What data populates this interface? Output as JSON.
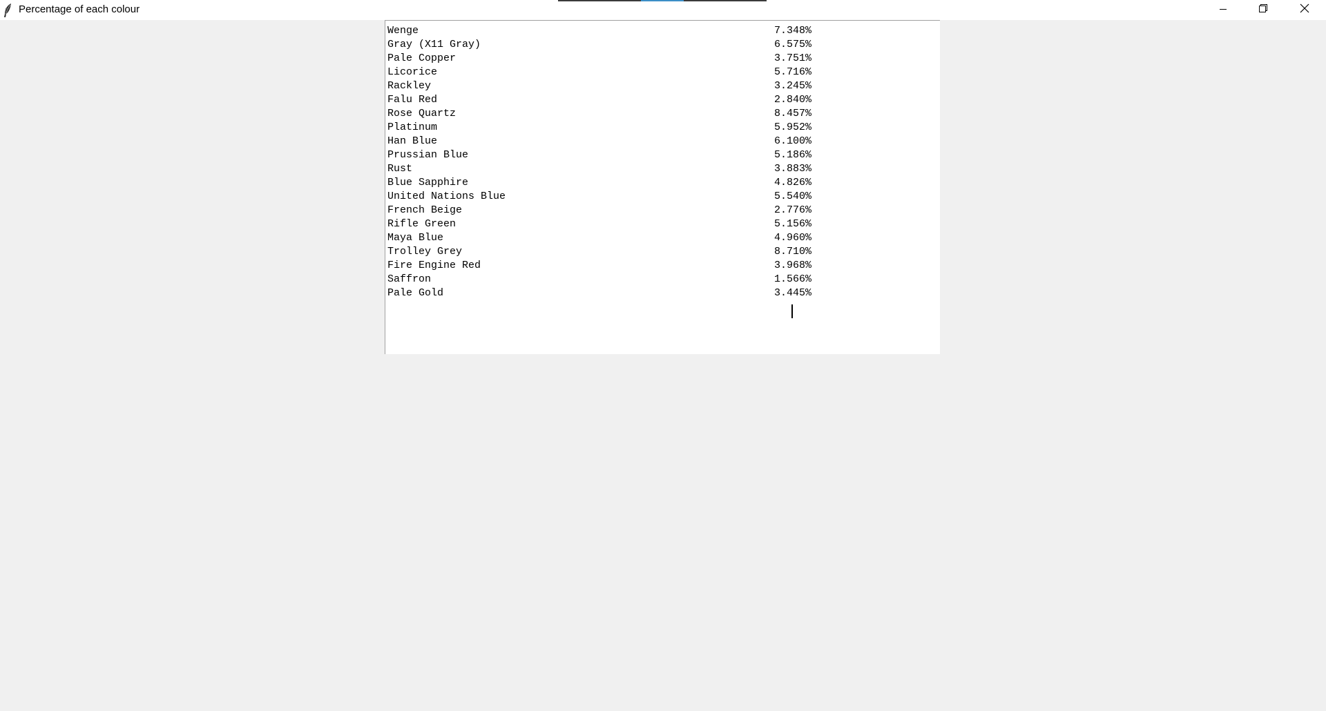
{
  "window": {
    "title": "Percentage of each colour",
    "icon": "feather-icon",
    "controls": {
      "minimize_icon": "minimize-icon",
      "maximize_icon": "restore-icon",
      "close_icon": "close-icon"
    }
  },
  "colours": [
    {
      "name": "Wenge",
      "percent": "7.348%"
    },
    {
      "name": "Gray (X11 Gray)",
      "percent": "6.575%"
    },
    {
      "name": "Pale Copper",
      "percent": "3.751%"
    },
    {
      "name": "Licorice",
      "percent": "5.716%"
    },
    {
      "name": "Rackley",
      "percent": "3.245%"
    },
    {
      "name": "Falu Red",
      "percent": "2.840%"
    },
    {
      "name": "Rose Quartz",
      "percent": "8.457%"
    },
    {
      "name": "Platinum",
      "percent": "5.952%"
    },
    {
      "name": "Han Blue",
      "percent": "6.100%"
    },
    {
      "name": "Prussian Blue",
      "percent": "5.186%"
    },
    {
      "name": "Rust",
      "percent": "3.883%"
    },
    {
      "name": "Blue Sapphire",
      "percent": "4.826%"
    },
    {
      "name": "United Nations Blue",
      "percent": "5.540%"
    },
    {
      "name": "French Beige",
      "percent": "2.776%"
    },
    {
      "name": "Rifle Green",
      "percent": "5.156%"
    },
    {
      "name": "Maya Blue",
      "percent": "4.960%"
    },
    {
      "name": "Trolley Grey",
      "percent": "8.710%"
    },
    {
      "name": "Fire Engine Red",
      "percent": "3.968%"
    },
    {
      "name": "Saffron",
      "percent": "1.566%"
    },
    {
      "name": "Pale Gold",
      "percent": "3.445%"
    }
  ]
}
